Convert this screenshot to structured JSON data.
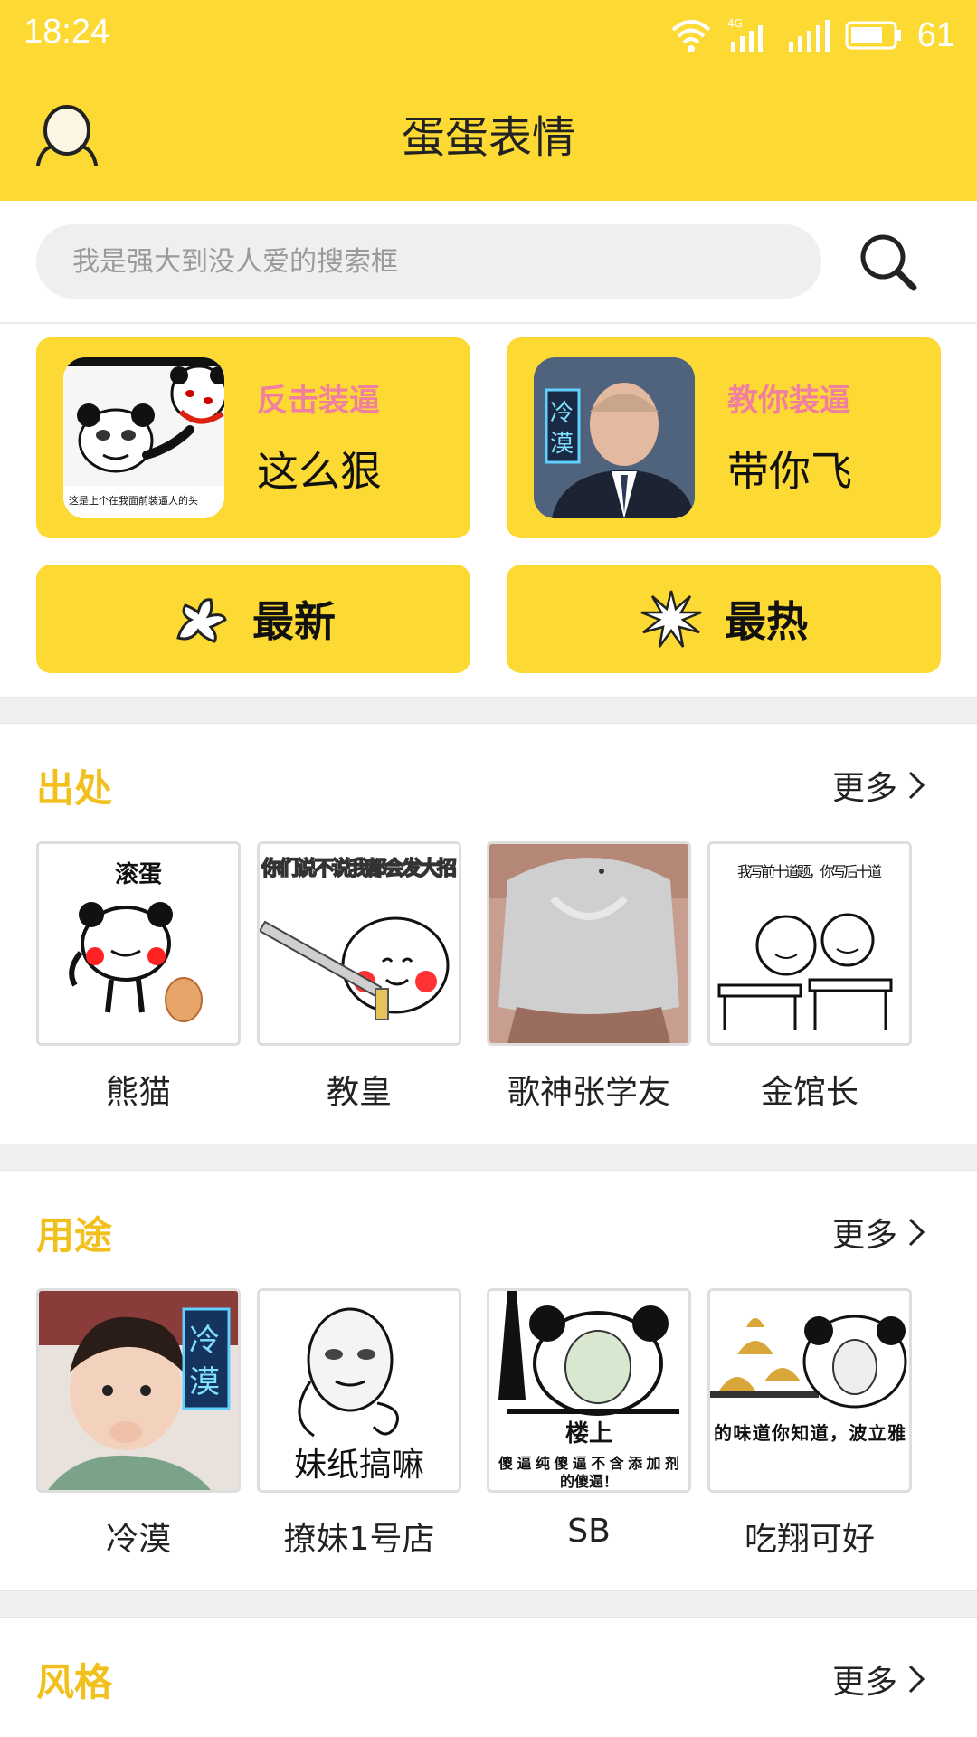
{
  "status_bar": {
    "time": "18:24",
    "network": "4G",
    "battery": "61"
  },
  "header": {
    "title": "蛋蛋表情"
  },
  "search": {
    "placeholder": "我是强大到没人爱的搜索框"
  },
  "feature_cards": [
    {
      "tag": "反击装逼",
      "title": "这么狠",
      "thumb_caption": "这是上个在我面前装逼人的头"
    },
    {
      "tag": "教你装逼",
      "title": "带你飞",
      "thumb_badge": "冷漠"
    }
  ],
  "quick_buttons": [
    {
      "label": "最新",
      "icon": "splash-star-icon"
    },
    {
      "label": "最热",
      "icon": "burst-icon"
    }
  ],
  "sections": [
    {
      "title": "出处",
      "more_label": "更多",
      "items": [
        {
          "caption": "熊猫",
          "image_text": "滚蛋"
        },
        {
          "caption": "教皇",
          "image_text": "你们说不说我都会发大招"
        },
        {
          "caption": "歌神张学友",
          "image_text": ""
        },
        {
          "caption": "金馆长",
          "image_text": "我写前十道题，你写后十道"
        }
      ]
    },
    {
      "title": "用途",
      "more_label": "更多",
      "items": [
        {
          "caption": "冷漠",
          "image_text": "冷漠"
        },
        {
          "caption": "撩妹1号店",
          "image_text": "妹纸搞嘛"
        },
        {
          "caption": "SB",
          "image_text": "楼上 傻逼纯傻逼不含添加剂的傻逼！"
        },
        {
          "caption": "吃翔可好",
          "image_text": "的味道你知道，波立雅"
        }
      ]
    },
    {
      "title": "风格",
      "more_label": "更多",
      "items": []
    }
  ],
  "colors": {
    "accent": "#fcd933",
    "section_title": "#f2c01c",
    "tag_pink": "#f07fa0"
  }
}
